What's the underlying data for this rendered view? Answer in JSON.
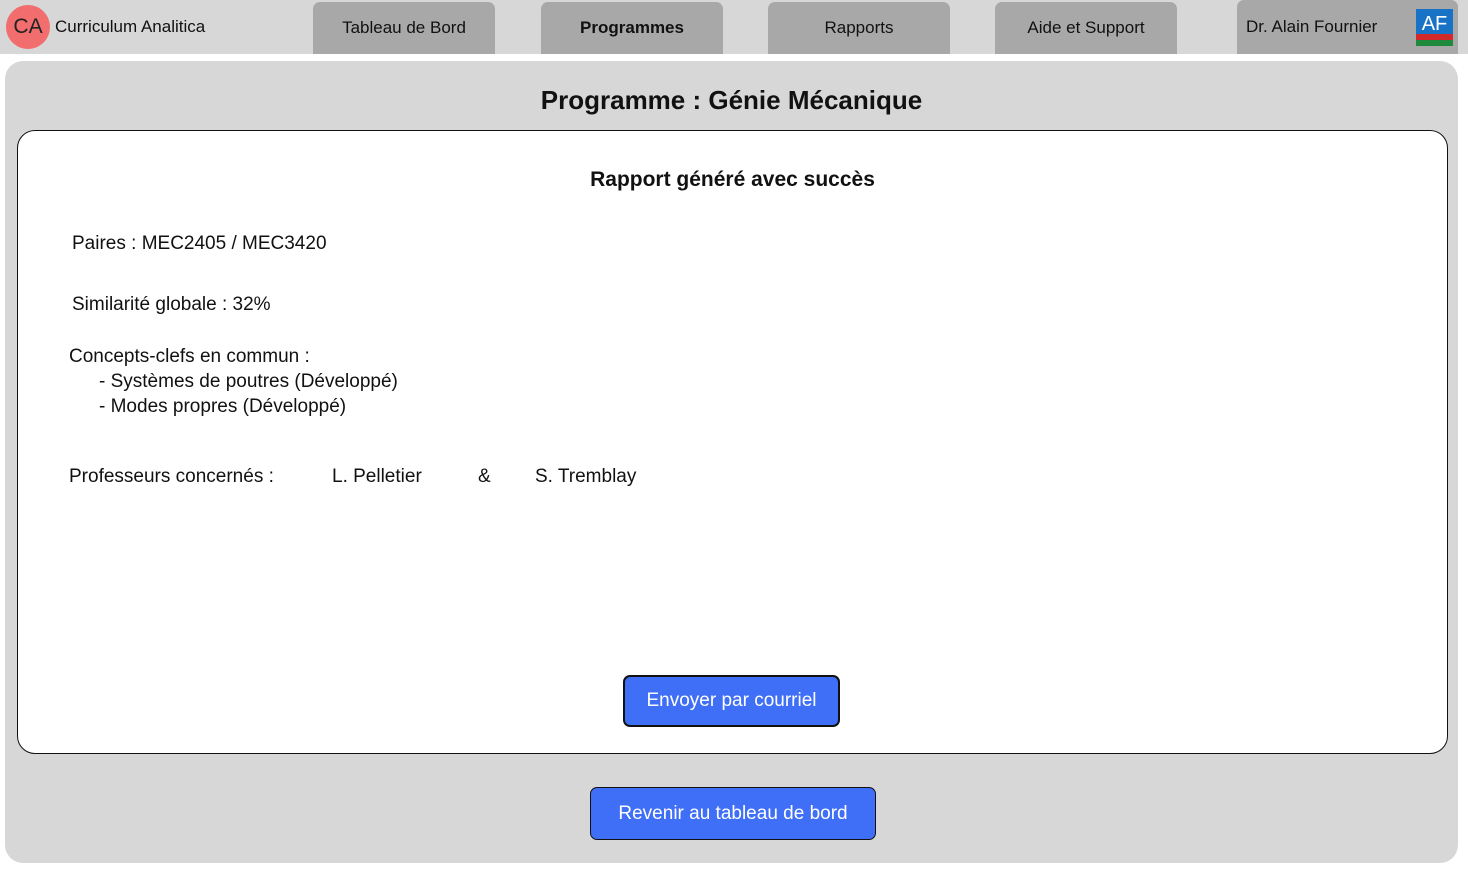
{
  "app": {
    "logo_text": "CA",
    "name": "Curriculum Analitica"
  },
  "nav": {
    "items": [
      {
        "label": "Tableau de Bord",
        "active": false
      },
      {
        "label": "Programmes",
        "active": true
      },
      {
        "label": "Rapports",
        "active": false
      },
      {
        "label": "Aide et Support",
        "active": false
      }
    ]
  },
  "user": {
    "name": "Dr. Alain Fournier",
    "initials": "AF"
  },
  "page": {
    "title": "Programme : Génie Mécanique"
  },
  "report": {
    "title": "Rapport généré avec succès",
    "pairs": "Paires : MEC2405 / MEC3420",
    "similarity": "Similarité globale : 32%",
    "concepts_heading": "Concepts-clefs en commun :",
    "concepts": [
      "- Systèmes de poutres (Développé)",
      "- Modes propres (Développé)"
    ],
    "professors_label": "Professeurs concernés :",
    "professor_1": "L. Pelletier",
    "professor_separator": "&",
    "professor_2": "S. Tremblay",
    "send_button": "Envoyer par courriel"
  },
  "footer": {
    "back_button": "Revenir au tableau de bord"
  },
  "colors": {
    "primary_button": "#3f6ef7",
    "logo_badge": "#f26d6d",
    "panel_background": "#d7d7d7",
    "nav_button": "#a8a8a8"
  }
}
